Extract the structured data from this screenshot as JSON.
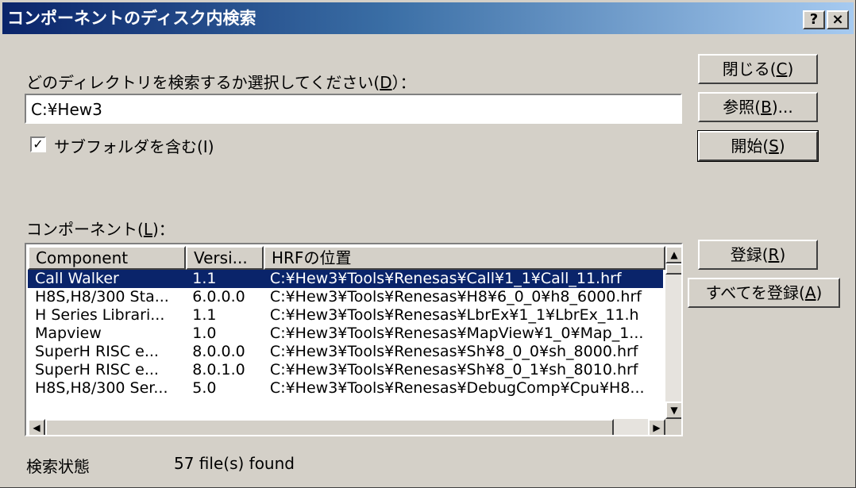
{
  "window": {
    "title": "コンポーネントのディスク内検索",
    "help_label": "?",
    "close_label": "×"
  },
  "directory": {
    "label_prefix": "どのディレクトリを検索するか選択してください(",
    "label_mnemonic": "D",
    "label_suffix": "）：",
    "value": "C:¥Hew3"
  },
  "subfolders": {
    "checked": true,
    "check_glyph": "✓",
    "label": "サブフォルダを含む(I)"
  },
  "buttons": {
    "close": {
      "pre": "閉じる(",
      "key": "C",
      "post": ")"
    },
    "browse": {
      "pre": "参照(",
      "key": "B",
      "post": ")..."
    },
    "start": {
      "pre": "開始(",
      "key": "S",
      "post": ")"
    },
    "register": {
      "pre": "登録(",
      "key": "R",
      "post": ")"
    },
    "register_all": {
      "pre": "すべてを登録(",
      "key": "A",
      "post": ")"
    }
  },
  "components": {
    "label_prefix": "コンポーネント(",
    "label_mnemonic": "L",
    "label_suffix": ")：",
    "columns": [
      "Component",
      "Versi...",
      "HRFの位置"
    ],
    "rows": [
      {
        "component": "Call Walker",
        "version": "1.1",
        "location": "C:¥Hew3¥Tools¥Renesas¥Call¥1_1¥Call_11.hrf",
        "selected": true
      },
      {
        "component": "H8S,H8/300 Sta...",
        "version": "6.0.0.0",
        "location": "C:¥Hew3¥Tools¥Renesas¥H8¥6_0_0¥h8_6000.hrf",
        "selected": false
      },
      {
        "component": "H Series Librari...",
        "version": "1.1",
        "location": "C:¥Hew3¥Tools¥Renesas¥LbrEx¥1_1¥LbrEx_11.h",
        "selected": false
      },
      {
        "component": "Mapview",
        "version": "1.0",
        "location": "C:¥Hew3¥Tools¥Renesas¥MapView¥1_0¥Map_1...",
        "selected": false
      },
      {
        "component": "SuperH RISC e...",
        "version": "8.0.0.0",
        "location": "C:¥Hew3¥Tools¥Renesas¥Sh¥8_0_0¥sh_8000.hrf",
        "selected": false
      },
      {
        "component": "SuperH RISC e...",
        "version": "8.0.1.0",
        "location": "C:¥Hew3¥Tools¥Renesas¥Sh¥8_0_1¥sh_8010.hrf",
        "selected": false
      },
      {
        "component": "H8S,H8/300 Ser...",
        "version": "5.0",
        "location": "C:¥Hew3¥Tools¥Renesas¥DebugComp¥Cpu¥H8...",
        "selected": false
      }
    ],
    "scroll_up": "▲",
    "scroll_down": "▼",
    "scroll_left": "◀",
    "scroll_right": "▶"
  },
  "status": {
    "label": "検索状態",
    "value": "57 file(s) found"
  }
}
